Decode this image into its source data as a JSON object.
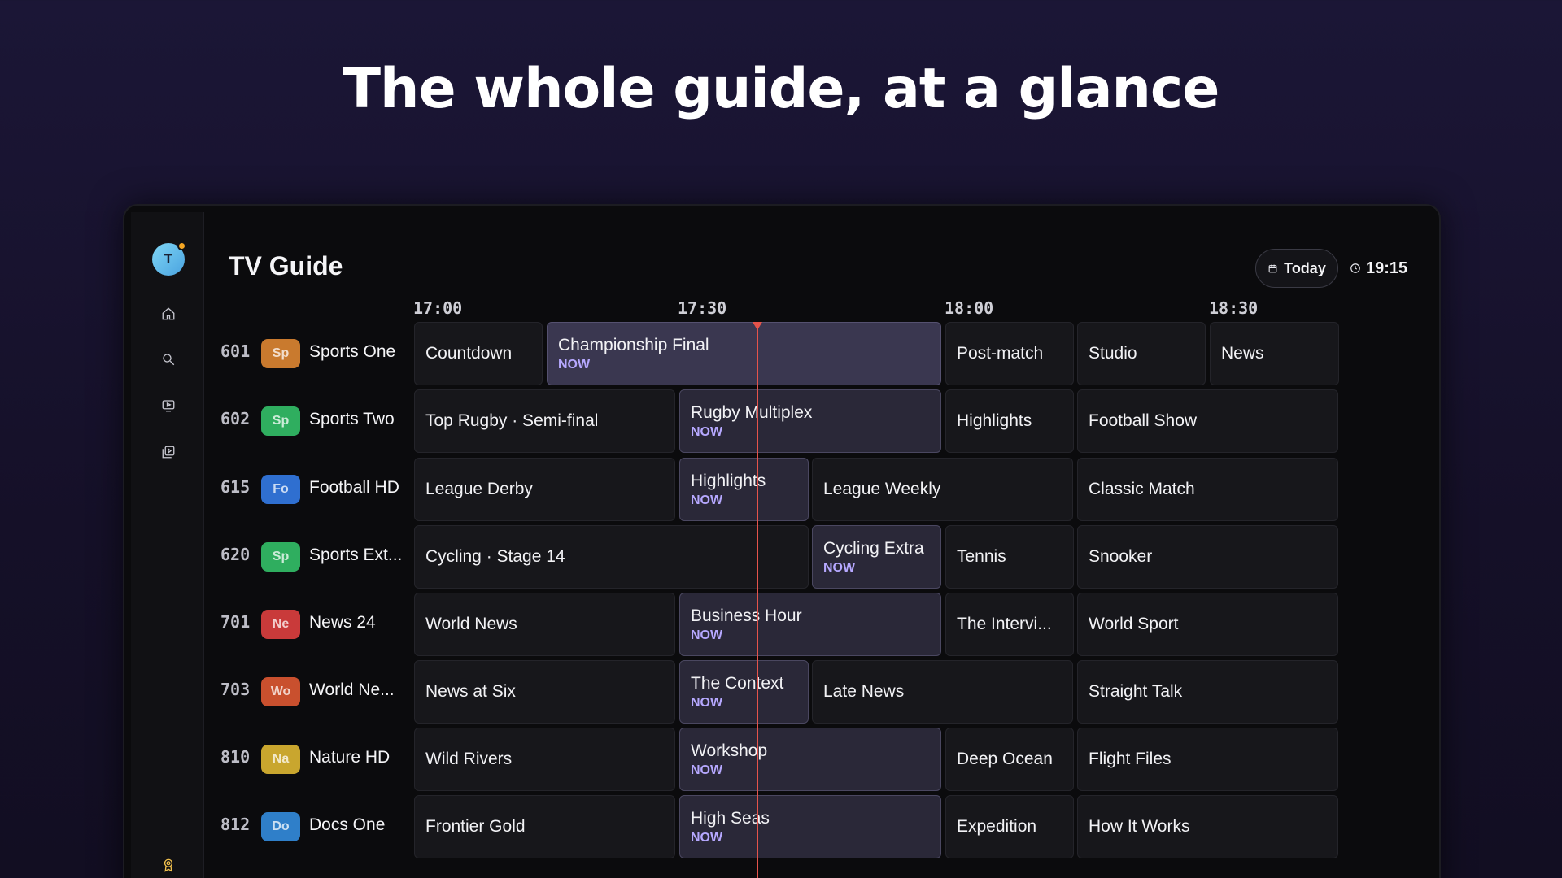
{
  "headline": "The whole guide, at a glance",
  "app": {
    "avatar_initial": "T",
    "title": "TV Guide",
    "today_label": "Today",
    "clock_time": "19:15",
    "nav_icons": [
      "home-icon",
      "search-icon",
      "tv-icon",
      "library-icon"
    ],
    "bottom_icon": "award-icon"
  },
  "timeline": [
    "17:00",
    "17:30",
    "18:00",
    "18:30"
  ],
  "channels": [
    {
      "number": "601",
      "badge": "Sp",
      "badge_color": "#c97a2e",
      "name": "Sports One",
      "programs": [
        {
          "title": "Countdown",
          "now": ""
        },
        {
          "title": "Championship Final",
          "now": "NOW"
        },
        {
          "title": "Post-match",
          "now": ""
        },
        {
          "title": "Studio",
          "now": ""
        },
        {
          "title": "News",
          "now": ""
        }
      ]
    },
    {
      "number": "602",
      "badge": "Sp",
      "badge_color": "#2fae5f",
      "name": "Sports Two",
      "programs": [
        {
          "title": "Top Rugby · Semi-final",
          "now": ""
        },
        {
          "title": "Rugby Multiplex",
          "now": "NOW"
        },
        {
          "title": "Highlights",
          "now": ""
        },
        {
          "title": "Football Show",
          "now": ""
        }
      ]
    },
    {
      "number": "615",
      "badge": "Fo",
      "badge_color": "#2f6fd0",
      "name": "Football HD",
      "programs": [
        {
          "title": "League Derby",
          "now": ""
        },
        {
          "title": "Highlights",
          "now": "NOW"
        },
        {
          "title": "League Weekly",
          "now": ""
        },
        {
          "title": "Classic Match",
          "now": ""
        }
      ]
    },
    {
      "number": "620",
      "badge": "Sp",
      "badge_color": "#2fae5f",
      "name": "Sports Ext...",
      "programs": [
        {
          "title": "Cycling · Stage 14",
          "now": ""
        },
        {
          "title": "Cycling Extra",
          "now": "NOW"
        },
        {
          "title": "Tennis",
          "now": ""
        },
        {
          "title": "Snooker",
          "now": ""
        }
      ]
    },
    {
      "number": "701",
      "badge": "Ne",
      "badge_color": "#c93a3a",
      "name": "News 24",
      "programs": [
        {
          "title": "World News",
          "now": ""
        },
        {
          "title": "Business Hour",
          "now": "NOW"
        },
        {
          "title": "The Intervi...",
          "now": ""
        },
        {
          "title": "World Sport",
          "now": ""
        }
      ]
    },
    {
      "number": "703",
      "badge": "Wo",
      "badge_color": "#c9502e",
      "name": "World Ne...",
      "programs": [
        {
          "title": "News at Six",
          "now": ""
        },
        {
          "title": "The Context",
          "now": "NOW"
        },
        {
          "title": "Late News",
          "now": ""
        },
        {
          "title": "Straight Talk",
          "now": ""
        }
      ]
    },
    {
      "number": "810",
      "badge": "Na",
      "badge_color": "#c9a62e",
      "name": "Nature HD",
      "programs": [
        {
          "title": "Wild Rivers",
          "now": ""
        },
        {
          "title": "Workshop",
          "now": "NOW"
        },
        {
          "title": "Deep Ocean",
          "now": ""
        },
        {
          "title": "Flight Files",
          "now": ""
        }
      ]
    },
    {
      "number": "812",
      "badge": "Do",
      "badge_color": "#2f7fc9",
      "name": "Docs One",
      "programs": [
        {
          "title": "Frontier Gold",
          "now": ""
        },
        {
          "title": "High Seas",
          "now": "NOW"
        },
        {
          "title": "Expedition",
          "now": ""
        },
        {
          "title": "How It Works",
          "now": ""
        }
      ]
    }
  ]
}
